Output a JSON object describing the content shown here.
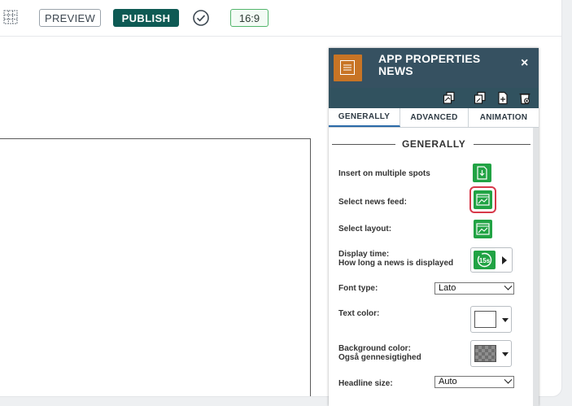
{
  "toolbar": {
    "preview_label": "PREVIEW",
    "publish_label": "PUBLISH",
    "aspect_ratio": "16:9",
    "grid_icon": "grid-icon",
    "check_icon": "check-circle-icon"
  },
  "panel": {
    "title_line1": "APP PROPERTIES",
    "title_line2": "NEWS",
    "close_label": "×",
    "header_color": "#365161",
    "tabs": [
      "GENERALLY",
      "ADVANCED",
      "ANIMATION"
    ],
    "active_tab": "GENERALLY",
    "section_title": "GENERALLY",
    "rows": {
      "insert_multiple": "Insert on multiple spots",
      "select_feed": "Select news feed:",
      "select_layout": "Select layout:",
      "display_time_1": "Display time:",
      "display_time_2": "How long a news is displayed",
      "font_type": "Font type:",
      "text_color": "Text color:",
      "bg_color_1": "Background color:",
      "bg_color_2": "Også gennesigtighed",
      "headline_size": "Headline size:"
    },
    "font_type_value": "Lato",
    "headline_size_value": "Auto",
    "timer_value": "15s",
    "accent_green": "#21a344",
    "highlight_red": "#d7394a",
    "text_color_value": "#ffffff"
  }
}
